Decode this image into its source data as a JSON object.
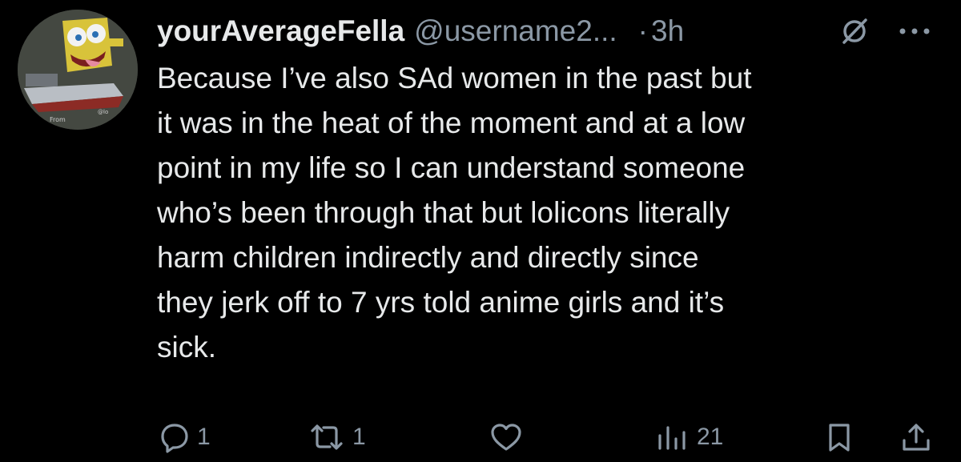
{
  "tweet": {
    "author": {
      "display_name": "yourAverageFella",
      "handle": "@username2...",
      "avatar_icon": "spongebob-avatar-icon"
    },
    "separator": "·",
    "timestamp": "3h",
    "text": "Because I’ve also SAd women in the past but\nit was in the heat of the moment and at a low\npoint in my life so I can understand someone\nwho’s been through that but lolicons literally\nharm children indirectly and directly since\nthey jerk off to 7 yrs told anime girls and it’s\nsick."
  },
  "actions": {
    "reply_count": "1",
    "retweet_count": "1",
    "like_count": "",
    "views_count": "21"
  },
  "icons": {
    "grok": "grok-icon",
    "more": "more-icon",
    "reply": "reply-icon",
    "retweet": "retweet-icon",
    "like": "heart-icon",
    "views": "views-icon",
    "bookmark": "bookmark-icon",
    "share": "share-icon"
  },
  "colors": {
    "background": "#000000",
    "text_primary": "#e7e9ea",
    "text_secondary": "#8b98a5"
  }
}
